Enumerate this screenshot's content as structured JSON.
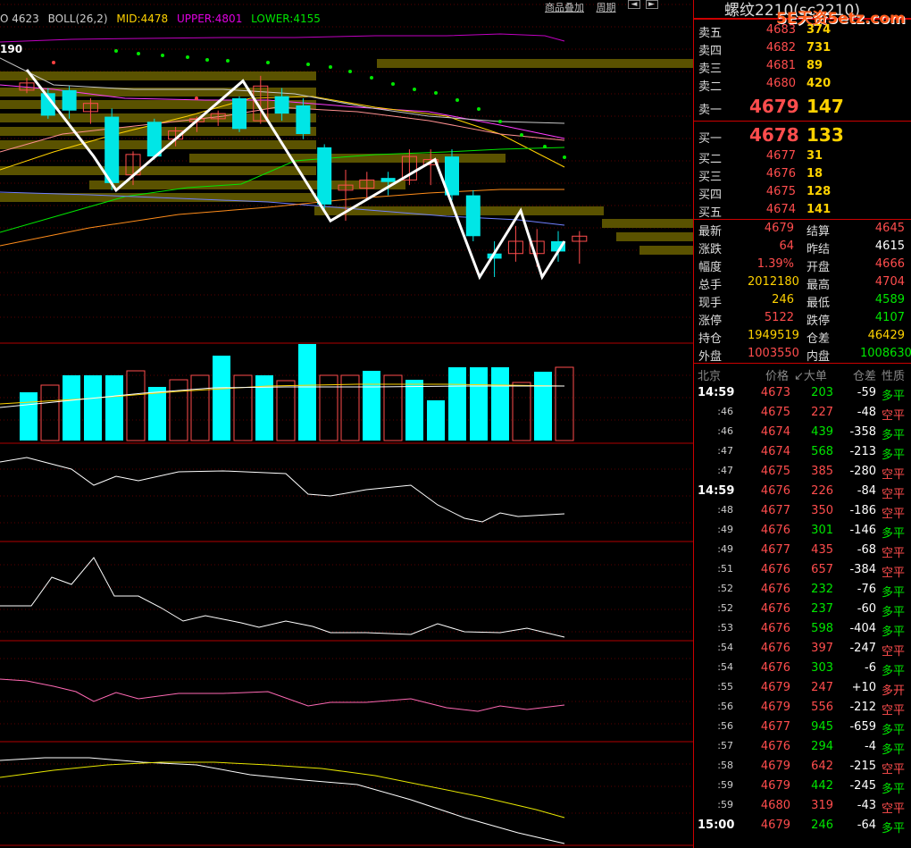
{
  "legend": {
    "boll_prefix": "O 4623",
    "boll_name": "BOLL(26,2)",
    "mid": "MID:4478",
    "upper": "UPPER:4801",
    "lower": "LOWER:4155"
  },
  "top_buttons": {
    "add_product": "商品叠加",
    "period": "周期",
    "left_arrow": "◄",
    "right_arrow": "►"
  },
  "price_tag": "190",
  "title": {
    "text": "螺纹2210(sc2210)",
    "watermark": "5E天资5etz.com"
  },
  "colors": {
    "up": "#ff4d4d",
    "down": "#00e6e6",
    "bull": "#00e600",
    "boll_upper": "#d400d4",
    "boll_mid": "#ffd200",
    "grid": "#8b0000",
    "panel_border": "#c00000"
  },
  "order_book": {
    "asks": [
      {
        "label": "卖五",
        "price": "4683",
        "vol": "374"
      },
      {
        "label": "卖四",
        "price": "4682",
        "vol": "731"
      },
      {
        "label": "卖三",
        "price": "4681",
        "vol": "89"
      },
      {
        "label": "卖二",
        "price": "4680",
        "vol": "420"
      }
    ],
    "ask1": {
      "label": "卖一",
      "price": "4679",
      "vol": "147"
    },
    "bid1": {
      "label": "买一",
      "price": "4678",
      "vol": "133"
    },
    "bids": [
      {
        "label": "买二",
        "price": "4677",
        "vol": "31"
      },
      {
        "label": "买三",
        "price": "4676",
        "vol": "18"
      },
      {
        "label": "买四",
        "price": "4675",
        "vol": "128"
      },
      {
        "label": "买五",
        "price": "4674",
        "vol": "141"
      }
    ]
  },
  "quote": [
    {
      "l1": "最新",
      "v1": "4679",
      "c1": "#ff4d4d",
      "l2": "结算",
      "v2": "4645",
      "c2": "#ff4d4d"
    },
    {
      "l1": "涨跌",
      "v1": "64",
      "c1": "#ff4d4d",
      "l2": "昨结",
      "v2": "4615",
      "c2": "#ffffff"
    },
    {
      "l1": "幅度",
      "v1": "1.39%",
      "c1": "#ff4d4d",
      "l2": "开盘",
      "v2": "4666",
      "c2": "#ff4d4d"
    },
    {
      "l1": "总手",
      "v1": "2012180",
      "c1": "#ffd200",
      "l2": "最高",
      "v2": "4704",
      "c2": "#ff4d4d"
    },
    {
      "l1": "现手",
      "v1": "246",
      "c1": "#ffd200",
      "l2": "最低",
      "v2": "4589",
      "c2": "#00e600"
    },
    {
      "l1": "涨停",
      "v1": "5122",
      "c1": "#ff4d4d",
      "l2": "跌停",
      "v2": "4107",
      "c2": "#00e600"
    },
    {
      "l1": "持仓",
      "v1": "1949519",
      "c1": "#ffd200",
      "l2": "仓差",
      "v2": "46429",
      "c2": "#ffd200"
    },
    {
      "l1": "外盘",
      "v1": "1003550",
      "c1": "#ff4d4d",
      "l2": "内盘",
      "v2": "1008630",
      "c2": "#00e600"
    }
  ],
  "ticks_header": {
    "place": "北京",
    "price": "价格",
    "volume": "↙大单",
    "oi_change": "仓差",
    "nature": "性质"
  },
  "ticks": [
    {
      "time": "14:59",
      "full": true,
      "price": "4673",
      "vol": "203",
      "vc": "#00e600",
      "diff": "-59",
      "kind": "多平",
      "kc": "#00e600"
    },
    {
      "time": ":46",
      "price": "4675",
      "vol": "227",
      "vc": "#ff4d4d",
      "diff": "-48",
      "kind": "空平",
      "kc": "#ff4d4d"
    },
    {
      "time": ":46",
      "price": "4674",
      "vol": "439",
      "vc": "#00e600",
      "diff": "-358",
      "kind": "多平",
      "kc": "#00e600"
    },
    {
      "time": ":47",
      "price": "4674",
      "vol": "568",
      "vc": "#00e600",
      "diff": "-213",
      "kind": "多平",
      "kc": "#00e600"
    },
    {
      "time": ":47",
      "price": "4675",
      "vol": "385",
      "vc": "#ff4d4d",
      "diff": "-280",
      "kind": "空平",
      "kc": "#ff4d4d"
    },
    {
      "time": "14:59",
      "full": true,
      "price": "4676",
      "vol": "226",
      "vc": "#ff4d4d",
      "diff": "-84",
      "kind": "空平",
      "kc": "#ff4d4d"
    },
    {
      "time": ":48",
      "price": "4677",
      "vol": "350",
      "vc": "#ff4d4d",
      "diff": "-186",
      "kind": "空平",
      "kc": "#ff4d4d"
    },
    {
      "time": ":49",
      "price": "4676",
      "vol": "301",
      "vc": "#00e600",
      "diff": "-146",
      "kind": "多平",
      "kc": "#00e600"
    },
    {
      "time": ":49",
      "price": "4677",
      "vol": "435",
      "vc": "#ff4d4d",
      "diff": "-68",
      "kind": "空平",
      "kc": "#ff4d4d"
    },
    {
      "time": ":51",
      "price": "4676",
      "vol": "657",
      "vc": "#ff4d4d",
      "diff": "-384",
      "kind": "空平",
      "kc": "#ff4d4d"
    },
    {
      "time": ":52",
      "price": "4676",
      "vol": "232",
      "vc": "#00e600",
      "diff": "-76",
      "kind": "多平",
      "kc": "#00e600"
    },
    {
      "time": ":52",
      "price": "4676",
      "vol": "237",
      "vc": "#00e600",
      "diff": "-60",
      "kind": "多平",
      "kc": "#00e600"
    },
    {
      "time": ":53",
      "price": "4676",
      "vol": "598",
      "vc": "#00e600",
      "diff": "-404",
      "kind": "多平",
      "kc": "#00e600"
    },
    {
      "time": ":54",
      "price": "4676",
      "vol": "397",
      "vc": "#ff4d4d",
      "diff": "-247",
      "kind": "空平",
      "kc": "#ff4d4d"
    },
    {
      "time": ":54",
      "price": "4676",
      "vol": "303",
      "vc": "#00e600",
      "diff": "-6",
      "kind": "多平",
      "kc": "#00e600"
    },
    {
      "time": ":55",
      "price": "4679",
      "vol": "247",
      "vc": "#ff4d4d",
      "diff": "+10",
      "kind": "多开",
      "kc": "#ff4d4d"
    },
    {
      "time": ":56",
      "price": "4679",
      "vol": "556",
      "vc": "#ff4d4d",
      "diff": "-212",
      "kind": "空平",
      "kc": "#ff4d4d"
    },
    {
      "time": ":56",
      "price": "4677",
      "vol": "945",
      "vc": "#00e600",
      "diff": "-659",
      "kind": "多平",
      "kc": "#00e600"
    },
    {
      "time": ":57",
      "price": "4676",
      "vol": "294",
      "vc": "#00e600",
      "diff": "-4",
      "kind": "多平",
      "kc": "#00e600"
    },
    {
      "time": ":58",
      "price": "4679",
      "vol": "642",
      "vc": "#ff4d4d",
      "diff": "-215",
      "kind": "空平",
      "kc": "#ff4d4d"
    },
    {
      "time": ":59",
      "price": "4679",
      "vol": "442",
      "vc": "#00e600",
      "diff": "-245",
      "kind": "多平",
      "kc": "#00e600"
    },
    {
      "time": ":59",
      "price": "4680",
      "vol": "319",
      "vc": "#ff4d4d",
      "diff": "-43",
      "kind": "空平",
      "kc": "#ff4d4d"
    },
    {
      "time": "15:00",
      "full": true,
      "price": "4679",
      "vol": "246",
      "vc": "#00e600",
      "diff": "-64",
      "kind": "多平",
      "kc": "#00e600"
    }
  ],
  "chart_data": {
    "type": "candlestick",
    "ylim": [
      4530,
      4810
    ],
    "candles": [
      {
        "o": 4748,
        "h": 4760,
        "l": 4745,
        "c": 4755,
        "up": true
      },
      {
        "o": 4745,
        "h": 4750,
        "l": 4720,
        "c": 4723,
        "up": false
      },
      {
        "o": 4748,
        "h": 4752,
        "l": 4720,
        "c": 4728,
        "up": false
      },
      {
        "o": 4727,
        "h": 4740,
        "l": 4715,
        "c": 4735,
        "up": true
      },
      {
        "o": 4722,
        "h": 4730,
        "l": 4650,
        "c": 4657,
        "up": false
      },
      {
        "o": 4665,
        "h": 4688,
        "l": 4655,
        "c": 4685,
        "up": true
      },
      {
        "o": 4717,
        "h": 4720,
        "l": 4680,
        "c": 4683,
        "up": false
      },
      {
        "o": 4700,
        "h": 4712,
        "l": 4693,
        "c": 4708,
        "up": true
      },
      {
        "o": 4717,
        "h": 4722,
        "l": 4707,
        "c": 4720,
        "up": true
      },
      {
        "o": 4720,
        "h": 4728,
        "l": 4713,
        "c": 4725,
        "up": true
      },
      {
        "o": 4740,
        "h": 4742,
        "l": 4707,
        "c": 4710,
        "up": false
      },
      {
        "o": 4718,
        "h": 4762,
        "l": 4715,
        "c": 4752,
        "up": true
      },
      {
        "o": 4742,
        "h": 4750,
        "l": 4718,
        "c": 4725,
        "up": false
      },
      {
        "o": 4733,
        "h": 4740,
        "l": 4700,
        "c": 4705,
        "up": false
      },
      {
        "o": 4692,
        "h": 4695,
        "l": 4630,
        "c": 4636,
        "up": false
      },
      {
        "o": 4655,
        "h": 4670,
        "l": 4620,
        "c": 4650,
        "up": true
      },
      {
        "o": 4652,
        "h": 4668,
        "l": 4640,
        "c": 4660,
        "up": true
      },
      {
        "o": 4662,
        "h": 4668,
        "l": 4645,
        "c": 4658,
        "up": false
      },
      {
        "o": 4660,
        "h": 4690,
        "l": 4655,
        "c": 4683,
        "up": true
      },
      {
        "o": 4680,
        "h": 4690,
        "l": 4655,
        "c": 4675,
        "up": true
      },
      {
        "o": 4683,
        "h": 4690,
        "l": 4640,
        "c": 4645,
        "up": false
      },
      {
        "o": 4645,
        "h": 4650,
        "l": 4600,
        "c": 4605,
        "up": false
      },
      {
        "o": 4588,
        "h": 4600,
        "l": 4565,
        "c": 4583,
        "up": false
      },
      {
        "o": 4588,
        "h": 4615,
        "l": 4580,
        "c": 4600,
        "up": true
      },
      {
        "o": 4588,
        "h": 4612,
        "l": 4575,
        "c": 4600,
        "up": true
      },
      {
        "o": 4600,
        "h": 4610,
        "l": 4580,
        "c": 4590,
        "up": false
      },
      {
        "o": 4600,
        "h": 4610,
        "l": 4578,
        "c": 4605,
        "up": true
      }
    ],
    "zigzag": [
      4768,
      4683,
      4650,
      4757,
      4620,
      4680,
      4565,
      4630,
      4565,
      4600
    ],
    "volume": [
      54,
      62,
      73,
      73,
      73,
      78,
      60,
      68,
      73,
      95,
      73,
      73,
      67,
      108,
      73,
      73,
      78,
      73,
      68,
      45,
      82,
      82,
      82,
      65,
      77,
      82
    ],
    "vol_up": [
      false,
      true,
      false,
      false,
      false,
      true,
      false,
      true,
      true,
      false,
      true,
      false,
      true,
      false,
      true,
      true,
      false,
      true,
      false,
      false,
      false,
      false,
      false,
      true,
      false,
      true
    ]
  }
}
